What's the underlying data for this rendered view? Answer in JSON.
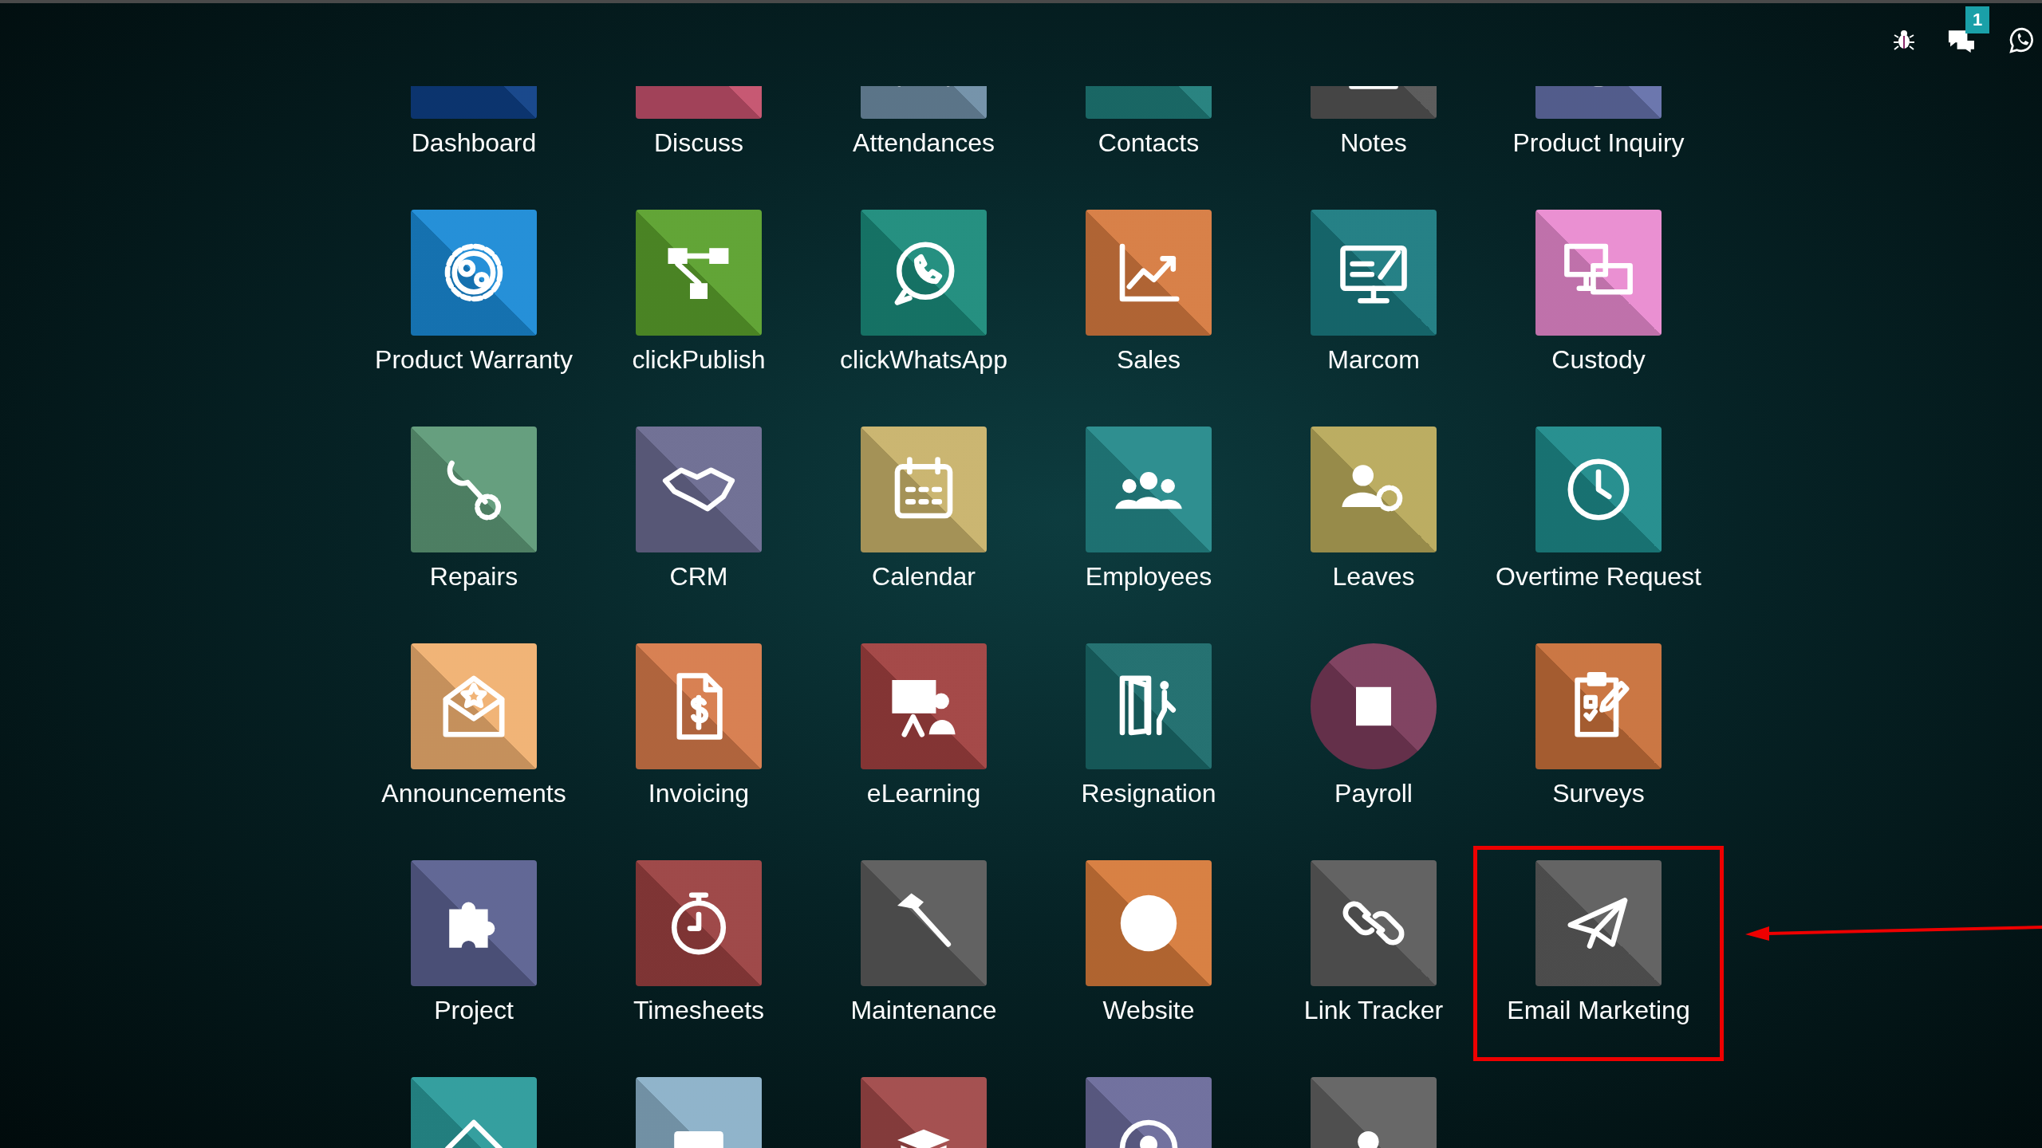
{
  "top_bar": {
    "message_count": "1"
  },
  "apps": [
    {
      "label": "Dashboard",
      "color": "#0e3f86",
      "kind": "square",
      "highlighted": false
    },
    {
      "label": "Discuss",
      "color": "#c4506c",
      "kind": "square",
      "highlighted": false
    },
    {
      "label": "Attendances",
      "color": "#6f8ea6",
      "kind": "square",
      "highlighted": false
    },
    {
      "label": "Contacts",
      "color": "#1f7d7a",
      "kind": "square",
      "highlighted": false
    },
    {
      "label": "Notes",
      "color": "#545454",
      "kind": "square",
      "highlighted": false
    },
    {
      "label": "Product Inquiry",
      "color": "#6470aa",
      "kind": "square",
      "highlighted": false
    },
    {
      "label": "Product Warranty",
      "color": "#1a8ad6",
      "kind": "square",
      "highlighted": false
    },
    {
      "label": "clickPublish",
      "color": "#5aa02c",
      "kind": "square",
      "highlighted": false
    },
    {
      "label": "clickWhatsApp",
      "color": "#1a8a7a",
      "kind": "square",
      "highlighted": false
    },
    {
      "label": "Sales",
      "color": "#d67a3f",
      "kind": "square",
      "highlighted": false
    },
    {
      "label": "Marcom",
      "color": "#1a7a80",
      "kind": "square",
      "highlighted": false
    },
    {
      "label": "Custody",
      "color": "#e98ad0",
      "kind": "square",
      "highlighted": false
    },
    {
      "label": "Repairs",
      "color": "#5e9a78",
      "kind": "square",
      "highlighted": false
    },
    {
      "label": "CRM",
      "color": "#6a6a90",
      "kind": "square",
      "highlighted": false
    },
    {
      "label": "Calendar",
      "color": "#c8b26a",
      "kind": "square",
      "highlighted": false
    },
    {
      "label": "Employees",
      "color": "#24898a",
      "kind": "square",
      "highlighted": false
    },
    {
      "label": "Leaves",
      "color": "#b8a95a",
      "kind": "square",
      "highlighted": false
    },
    {
      "label": "Overtime Request",
      "color": "#1d8a8a",
      "kind": "square",
      "highlighted": false
    },
    {
      "label": "Announcements",
      "color": "#f0b070",
      "kind": "square",
      "highlighted": false
    },
    {
      "label": "Invoicing",
      "color": "#d67a4a",
      "kind": "square",
      "highlighted": false
    },
    {
      "label": "eLearning",
      "color": "#a0403f",
      "kind": "square",
      "highlighted": false
    },
    {
      "label": "Resignation",
      "color": "#1a6a6a",
      "kind": "square",
      "highlighted": false
    },
    {
      "label": "Payroll",
      "color": "#7a3a5a",
      "kind": "round",
      "highlighted": false
    },
    {
      "label": "Surveys",
      "color": "#c8703a",
      "kind": "square",
      "highlighted": false
    },
    {
      "label": "Project",
      "color": "#5a6090",
      "kind": "square",
      "highlighted": false
    },
    {
      "label": "Timesheets",
      "color": "#9a4040",
      "kind": "square",
      "highlighted": false
    },
    {
      "label": "Maintenance",
      "color": "#5a5a5a",
      "kind": "square",
      "highlighted": false
    },
    {
      "label": "Website",
      "color": "#d67a3a",
      "kind": "square",
      "highlighted": false
    },
    {
      "label": "Link Tracker",
      "color": "#5b5b5b",
      "kind": "square",
      "highlighted": false
    },
    {
      "label": "Email Marketing",
      "color": "#5c5c5c",
      "kind": "square",
      "highlighted": true
    },
    {
      "color": "#2a9a9a",
      "kind": "square",
      "highlighted": false
    },
    {
      "color": "#8ab0c8",
      "kind": "square",
      "highlighted": false
    },
    {
      "color": "#a04848",
      "kind": "square",
      "highlighted": false
    },
    {
      "color": "#6a6a9a",
      "kind": "square",
      "highlighted": false
    },
    {
      "color": "#606060",
      "kind": "square",
      "highlighted": false
    }
  ]
}
